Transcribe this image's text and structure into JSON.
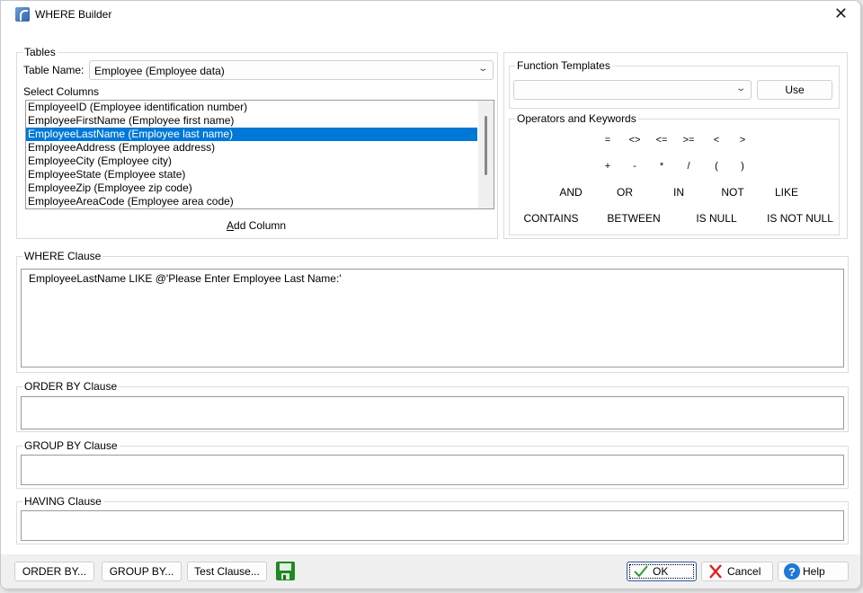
{
  "window": {
    "title": "WHERE Builder",
    "close_glyph": "✕"
  },
  "tables": {
    "group_label": "Tables",
    "table_name_label": "Table Name:",
    "table_name_value": "Employee  (Employee data)",
    "select_columns_label": "Select Columns",
    "columns": [
      "EmployeeID  (Employee identification number)",
      "EmployeeFirstName  (Employee first name)",
      "EmployeeLastName  (Employee last name)",
      "EmployeeAddress  (Employee address)",
      "EmployeeCity  (Employee city)",
      "EmployeeState  (Employee state)",
      "EmployeeZip  (Employee zip code)",
      "EmployeeAreaCode  (Employee area code)"
    ],
    "selected_column": "EmployeeLastName  (Employee last name)",
    "add_column_prefix": "A",
    "add_column_rest": "dd Column"
  },
  "function_templates": {
    "group_label": "Function Templates",
    "selected_value": "",
    "use_label": "Use"
  },
  "operators": {
    "group_label": "Operators and Keywords",
    "row1": [
      "=",
      "<>",
      "<=",
      ">=",
      "<",
      ">"
    ],
    "row2": [
      "+",
      "-",
      "*",
      "/",
      "(",
      ")"
    ],
    "row3": [
      "AND",
      "OR",
      "IN",
      "NOT",
      "LIKE"
    ],
    "row4": [
      "CONTAINS",
      "BETWEEN",
      "IS NULL",
      "IS NOT NULL"
    ]
  },
  "where_clause": {
    "label": "WHERE Clause",
    "value": "EmployeeLastName  LIKE @'Please Enter Employee Last Name:'"
  },
  "order_by_clause": {
    "label": "ORDER BY Clause",
    "value": ""
  },
  "group_by_clause": {
    "label": "GROUP BY Clause",
    "value": ""
  },
  "having_clause": {
    "label": "HAVING Clause",
    "value": ""
  },
  "footer": {
    "order_by_button": "ORDER BY...",
    "group_by_button": "GROUP BY...",
    "test_clause_button": "Test Clause...",
    "ok_button": "OK",
    "cancel_button": "Cancel",
    "help_button": "Help"
  },
  "colors": {
    "selection": "#0078d7",
    "ok_check": "#2e9e2e",
    "cancel_x": "#e02020",
    "help_circle": "#1e78d8",
    "save_icon": "#1f8a1f"
  }
}
